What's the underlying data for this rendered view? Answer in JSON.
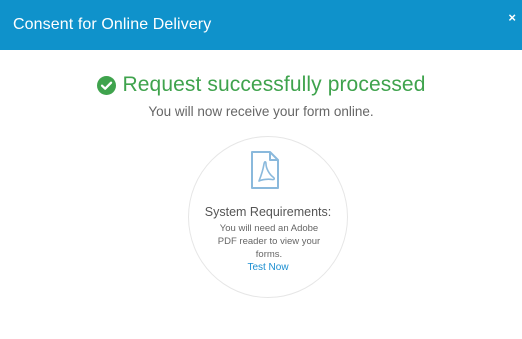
{
  "header": {
    "title": "Consent for Online Delivery",
    "close_label": "×"
  },
  "status": {
    "icon": "check-circle-icon",
    "message": "Request successfully processed",
    "subtitle": "You will now receive your form online."
  },
  "requirements": {
    "icon": "pdf-document-icon",
    "title": "System Requirements:",
    "text": "You will need an Adobe PDF reader to view your forms.",
    "link_label": "Test Now"
  },
  "colors": {
    "header_bg": "#0f92cb",
    "success": "#3fa34d",
    "link": "#1a8ed1",
    "icon_accent": "#8ab9dc"
  }
}
